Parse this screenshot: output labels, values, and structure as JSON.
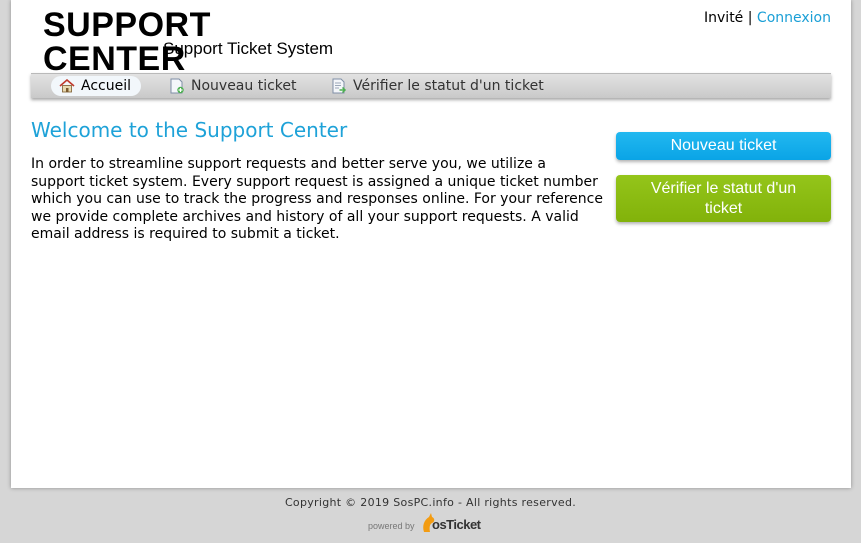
{
  "header": {
    "logo_title": "SUPPORT CENTER",
    "logo_subtitle": "Support Ticket System",
    "user_label": "Invité",
    "separator": "|",
    "login_link": "Connexion"
  },
  "nav": {
    "items": [
      {
        "label": "Accueil",
        "icon": "home-icon",
        "active": true
      },
      {
        "label": "Nouveau ticket",
        "icon": "new-ticket-icon",
        "active": false
      },
      {
        "label": "Vérifier le statut d'un ticket",
        "icon": "check-status-icon",
        "active": false
      }
    ]
  },
  "main": {
    "title": "Welcome to the Support Center",
    "intro": "In order to streamline support requests and better serve you, we utilize a support ticket system. Every support request is assigned a unique ticket number which you can use to track the progress and responses online. For your reference we provide complete archives and history of all your support requests. A valid email address is required to submit a ticket."
  },
  "sidebar": {
    "new_ticket_button": "Nouveau ticket",
    "check_status_button": "Vérifier le statut d'un ticket"
  },
  "footer": {
    "copyright": "Copyright © 2019 SosPC.info - All rights reserved.",
    "powered_by": "powered by",
    "brand": "osTicket"
  },
  "colors": {
    "accent_blue": "#1ea2d8",
    "button_blue": "#0aa4e6",
    "button_green": "#82b20a",
    "page_background": "#d6d6d6"
  }
}
